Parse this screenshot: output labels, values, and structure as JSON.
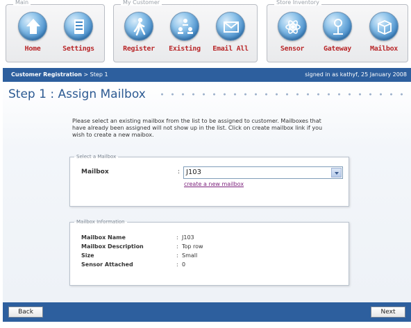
{
  "toolbar": {
    "groups": [
      {
        "title": "Main"
      },
      {
        "title": "My Customer"
      },
      {
        "title": "Store Inventory"
      }
    ],
    "tools": [
      {
        "label": "Home",
        "icon": "home-icon"
      },
      {
        "label": "Settings",
        "icon": "settings-icon"
      },
      {
        "label": "Register",
        "icon": "register-icon"
      },
      {
        "label": "Existing",
        "icon": "existing-icon"
      },
      {
        "label": "Email All",
        "icon": "email-icon"
      },
      {
        "label": "Sensor",
        "icon": "sensor-icon"
      },
      {
        "label": "Gateway",
        "icon": "gateway-icon"
      },
      {
        "label": "Mailbox",
        "icon": "mailbox-icon"
      }
    ]
  },
  "header": {
    "crumb_main": "Customer Registration",
    "crumb_rest": " > Step 1",
    "signed_in": "signed in as kathyf, 25 January 2008"
  },
  "page": {
    "title": "Step 1 : Assign Mailbox",
    "intro": "Please select an existing mailbox from the list to be assigned to customer. Mailboxes that have already been assigned will not show up in the list. Click on create mailbox link if you wish to create a new maibox."
  },
  "select_box": {
    "legend": "Select a Mailbox",
    "label": "Mailbox",
    "colon": ":",
    "selected": "J103",
    "link": "create a new mailbox"
  },
  "info_box": {
    "legend": "Mailbox Information",
    "rows": [
      {
        "key": "Mailbox Name",
        "value": "J103"
      },
      {
        "key": "Mailbox Description",
        "value": "Top row"
      },
      {
        "key": "Size",
        "value": "Small"
      },
      {
        "key": "Sensor Attached",
        "value": "0"
      }
    ]
  },
  "footer": {
    "back": "Back",
    "next": "Next"
  },
  "colors": {
    "header_blue": "#2d5f9e",
    "title_blue": "#2c5a92",
    "tool_label_red": "#b9282a",
    "link_purple": "#7a1f7a"
  }
}
